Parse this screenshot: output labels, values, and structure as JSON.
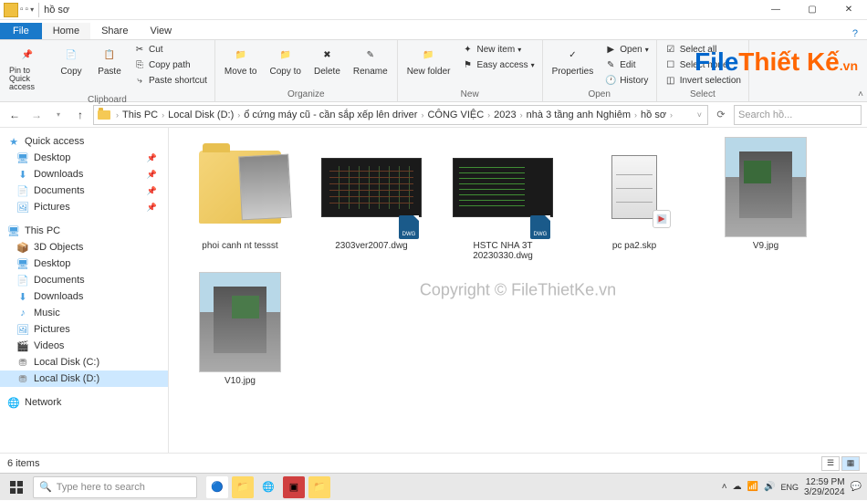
{
  "titlebar": {
    "title": "hồ sơ",
    "min": "—",
    "max": "▢",
    "close": "✕"
  },
  "menutabs": {
    "file": "File",
    "home": "Home",
    "share": "Share",
    "view": "View"
  },
  "ribbon": {
    "clipboard": {
      "label": "Clipboard",
      "pin": "Pin to Quick access",
      "copy": "Copy",
      "paste": "Paste",
      "cut": "Cut",
      "copypath": "Copy path",
      "pasteshortcut": "Paste shortcut"
    },
    "organize": {
      "label": "Organize",
      "moveto": "Move to",
      "copyto": "Copy to",
      "delete": "Delete",
      "rename": "Rename"
    },
    "new": {
      "label": "New",
      "newfolder": "New folder",
      "newitem": "New item",
      "easyaccess": "Easy access"
    },
    "open": {
      "label": "Open",
      "properties": "Properties",
      "open": "Open",
      "edit": "Edit",
      "history": "History"
    },
    "select": {
      "label": "Select",
      "selectall": "Select all",
      "selectnone": "Select none",
      "invert": "Invert selection"
    },
    "logo": {
      "file": "File",
      "thietke": "Thiết Kế",
      "vn": ".vn"
    }
  },
  "breadcrumb": {
    "items": [
      "This PC",
      "Local Disk (D:)",
      "ổ cứng máy cũ - cần sắp xếp lên driver",
      "CÔNG VIỆC",
      "2023",
      "nhà 3 tầng anh Nghiêm",
      "hồ sơ"
    ],
    "search_placeholder": "Search hồ..."
  },
  "sidebar": {
    "quickaccess": "Quick access",
    "qa_items": [
      {
        "label": "Desktop",
        "pinned": true
      },
      {
        "label": "Downloads",
        "pinned": true
      },
      {
        "label": "Documents",
        "pinned": true
      },
      {
        "label": "Pictures",
        "pinned": true
      }
    ],
    "thispc": "This PC",
    "pc_items": [
      "3D Objects",
      "Desktop",
      "Documents",
      "Downloads",
      "Music",
      "Pictures",
      "Videos",
      "Local Disk (C:)",
      "Local Disk (D:)"
    ],
    "network": "Network"
  },
  "files": [
    {
      "name": "phoi canh nt tessst",
      "type": "folder"
    },
    {
      "name": "2303ver2007.dwg",
      "type": "dwg"
    },
    {
      "name": "HSTC NHA 3T 20230330.dwg",
      "type": "dwg2"
    },
    {
      "name": "pc pa2.skp",
      "type": "skp"
    },
    {
      "name": "V9.jpg",
      "type": "jpg"
    },
    {
      "name": "V10.jpg",
      "type": "jpg2"
    }
  ],
  "watermark": "Copyright © FileThietKe.vn",
  "status": {
    "count": "6 items"
  },
  "taskbar": {
    "search": "Type here to search",
    "time": "12:59 PM",
    "date": "3/29/2024"
  }
}
